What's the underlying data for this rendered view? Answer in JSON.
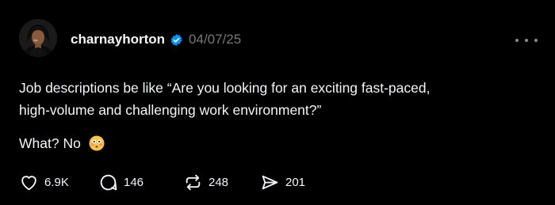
{
  "post": {
    "username": "charnayhorton",
    "date": "04/07/25",
    "text_line_1": "Job descriptions be like “Are you looking for an exciting fast-paced,",
    "text_line_2": "high-volume and challenging work environment?”",
    "text_line_3": "What? No",
    "emoji_name": "flushed-face-emoji"
  },
  "actions": {
    "likes": "6.9K",
    "replies": "146",
    "reposts": "248",
    "shares": "201"
  },
  "colors": {
    "background": "#000000",
    "text": "#f3f5f7",
    "muted": "#777777",
    "verified_blue": "#0095f6"
  }
}
